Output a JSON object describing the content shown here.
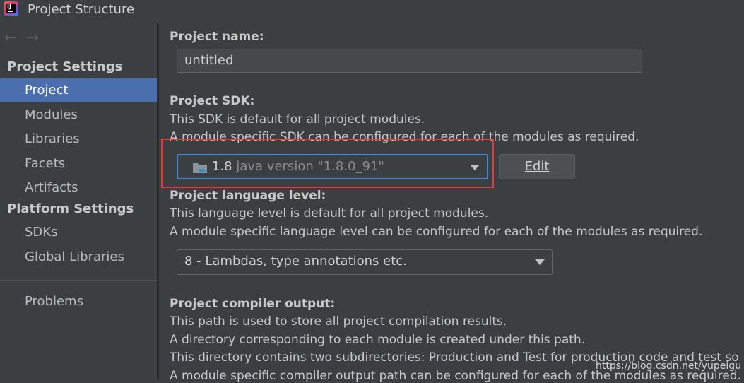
{
  "window": {
    "title": "Project Structure",
    "app_icon": "intellij-icon"
  },
  "nav": {
    "back_icon": "←",
    "forward_icon": "→"
  },
  "sidebar": {
    "project_settings_header": "Project Settings",
    "project_settings_items": [
      {
        "label": "Project",
        "selected": true
      },
      {
        "label": "Modules"
      },
      {
        "label": "Libraries"
      },
      {
        "label": "Facets"
      },
      {
        "label": "Artifacts"
      }
    ],
    "platform_settings_header": "Platform Settings",
    "platform_settings_items": [
      {
        "label": "SDKs"
      },
      {
        "label": "Global Libraries"
      }
    ],
    "problems": "Problems"
  },
  "main": {
    "project_name": {
      "label": "Project name:",
      "value": "untitled"
    },
    "project_sdk": {
      "label": "Project SDK:",
      "desc1": "This SDK is default for all project modules.",
      "desc2": "A module specific SDK can be configured for each of the modules as required.",
      "selected_version": "1.8",
      "selected_detail": "java version \"1.8.0_91\"",
      "edit_label": "Edit"
    },
    "language_level": {
      "label": "Project language level:",
      "desc1": "This language level is default for all project modules.",
      "desc2": "A module specific language level can be configured for each of the modules as required.",
      "selected": "8 - Lambdas, type annotations etc."
    },
    "compiler_output": {
      "label": "Project compiler output:",
      "desc1": "This path is used to store all project compilation results.",
      "desc2": "A directory corresponding to each module is created under this path.",
      "desc3": "This directory contains two subdirectories: Production and Test for production code and test so",
      "desc4": "A module specific compiler output path can be configured for each of the modules as required."
    }
  },
  "watermark": "https://blog.csdn.net/yupeigu",
  "colors": {
    "selection": "#4b6eaf",
    "highlight_box": "#e03c3c",
    "focus_border": "#4a88c7"
  }
}
